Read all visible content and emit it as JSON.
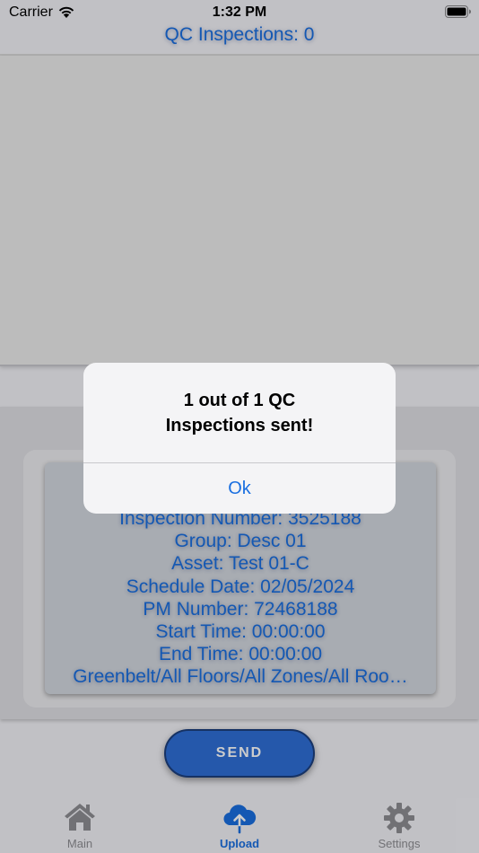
{
  "status_bar": {
    "carrier": "Carrier",
    "time": "1:32 PM"
  },
  "nav": {
    "title": "QC Inspections: 0"
  },
  "card": {
    "lines": [
      "Inspection Number: 3525188",
      "Group: Desc 01",
      "Asset: Test 01-C",
      "Schedule Date: 02/05/2024",
      "PM Number: 72468188",
      "Start Time: 00:00:00",
      "End Time: 00:00:00",
      "Greenbelt/All Floors/All Zones/All Roo…"
    ]
  },
  "send_button": {
    "label": "SEND"
  },
  "tabs": [
    {
      "label": "Main",
      "icon": "house-icon"
    },
    {
      "label": "Upload",
      "icon": "cloud-upload-icon"
    },
    {
      "label": "Settings",
      "icon": "gear-icon"
    }
  ],
  "alert": {
    "title_line1": "1 out of 1 QC",
    "title_line2": "Inspections sent!",
    "ok_label": "Ok"
  },
  "colors": {
    "accent": "#1a6fe0",
    "button": "#2f6fd6",
    "inactive": "#8e8e93"
  }
}
